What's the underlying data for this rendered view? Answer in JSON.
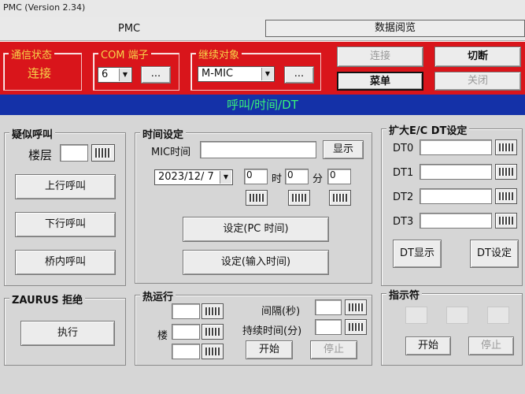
{
  "window": {
    "title": "PMC (Version 2.34)"
  },
  "topbar": {
    "app_label": "PMC",
    "data_browse": "数据阅览"
  },
  "status": {
    "group_title": "通信状态",
    "value": "连接"
  },
  "com": {
    "group_title": "COM 端子",
    "port": "6",
    "dots": "..."
  },
  "relay": {
    "group_title": "继续对象",
    "target": "M-MIC",
    "dots": "..."
  },
  "controls": {
    "connect": "连接",
    "switch": "切断",
    "menu": "菜单",
    "close": "关闭"
  },
  "banner": {
    "text": "呼叫/时间/DT"
  },
  "simcall": {
    "group_title": "疑似呼叫",
    "floor_label": "楼层",
    "up": "上行呼叫",
    "down": "下行呼叫",
    "car": "桥内呼叫"
  },
  "time": {
    "group_title": "时间设定",
    "mic_label": "MIC时间",
    "show": "显示",
    "date": "2023/12/ 7",
    "hour": "0",
    "hour_unit": "时",
    "minute": "0",
    "minute_unit": "分",
    "second": "0",
    "set_pc": "设定(PC 时间)",
    "set_input": "设定(输入时间)"
  },
  "dt": {
    "group_title": "扩大E/C  DT设定",
    "labels": [
      "DT0",
      "DT1",
      "DT2",
      "DT3"
    ],
    "show": "DT显示",
    "set": "DT设定"
  },
  "zaurus": {
    "group_title": "ZAURUS 拒绝",
    "exec": "执行"
  },
  "hotrun": {
    "group_title": "热运行",
    "floor_label": "楼",
    "interval_label": "间隔(秒)",
    "duration_label": "持续时间(分)",
    "start": "开始",
    "stop": "停止"
  },
  "indicator": {
    "group_title": "指示符",
    "start": "开始",
    "stop": "停止"
  }
}
